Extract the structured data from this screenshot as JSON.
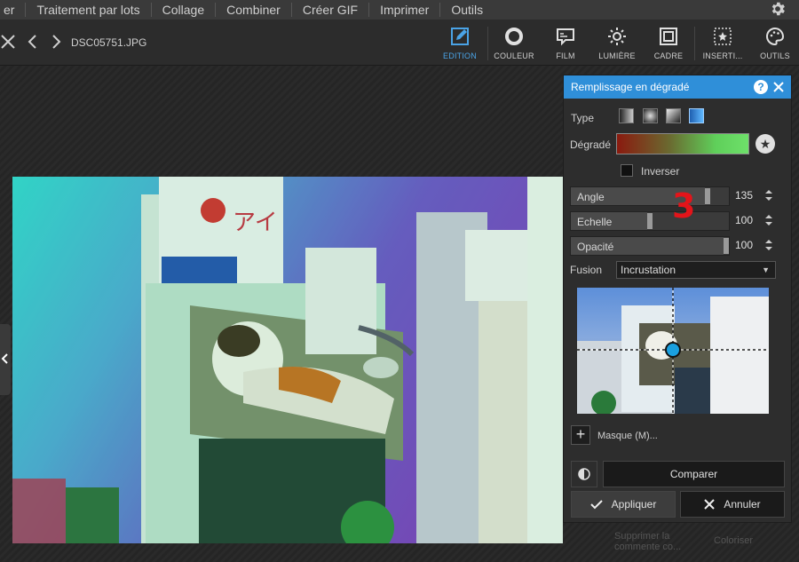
{
  "menubar": {
    "items": [
      "er",
      "Traitement par lots",
      "Collage",
      "Combiner",
      "Créer GIF",
      "Imprimer",
      "Outils"
    ]
  },
  "toolbar": {
    "filename": "DSC05751.JPG",
    "tools": [
      {
        "label": "EDITION",
        "icon": "edit-icon",
        "active": true
      },
      {
        "label": "COULEUR",
        "icon": "color-ring-icon"
      },
      {
        "label": "FILM",
        "icon": "film-icon"
      },
      {
        "label": "LUMIÈRE",
        "icon": "sun-icon"
      },
      {
        "label": "CADRE",
        "icon": "frame-icon"
      },
      {
        "label": "INSERTI...",
        "icon": "insert-star-icon"
      },
      {
        "label": "OUTILS",
        "icon": "palette-icon"
      }
    ]
  },
  "panel": {
    "title": "Remplissage en dégradé",
    "type_label": "Type",
    "gradient_label": "Dégradé",
    "invert_label": "Inverser",
    "angle": {
      "label": "Angle",
      "value": "135",
      "fraction": 0.88
    },
    "scale": {
      "label": "Echelle",
      "value": "100",
      "fraction": 0.5
    },
    "opacity": {
      "label": "Opacité",
      "value": "100",
      "fraction": 1.0
    },
    "fusion_label": "Fusion",
    "fusion_value": "Incrustation",
    "mask_label": "Masque (M)...",
    "compare_label": "Comparer",
    "apply_label": "Appliquer",
    "cancel_label": "Annuler",
    "colors": {
      "gradient_start": "#8a1a0f",
      "gradient_end": "#6ee06a",
      "accent": "#2f8fd9"
    }
  },
  "behind": {
    "remove_label_1": "Supprimer la",
    "remove_label_2": "commente co...",
    "colorize_label": "Coloriser"
  },
  "annotation": "3"
}
